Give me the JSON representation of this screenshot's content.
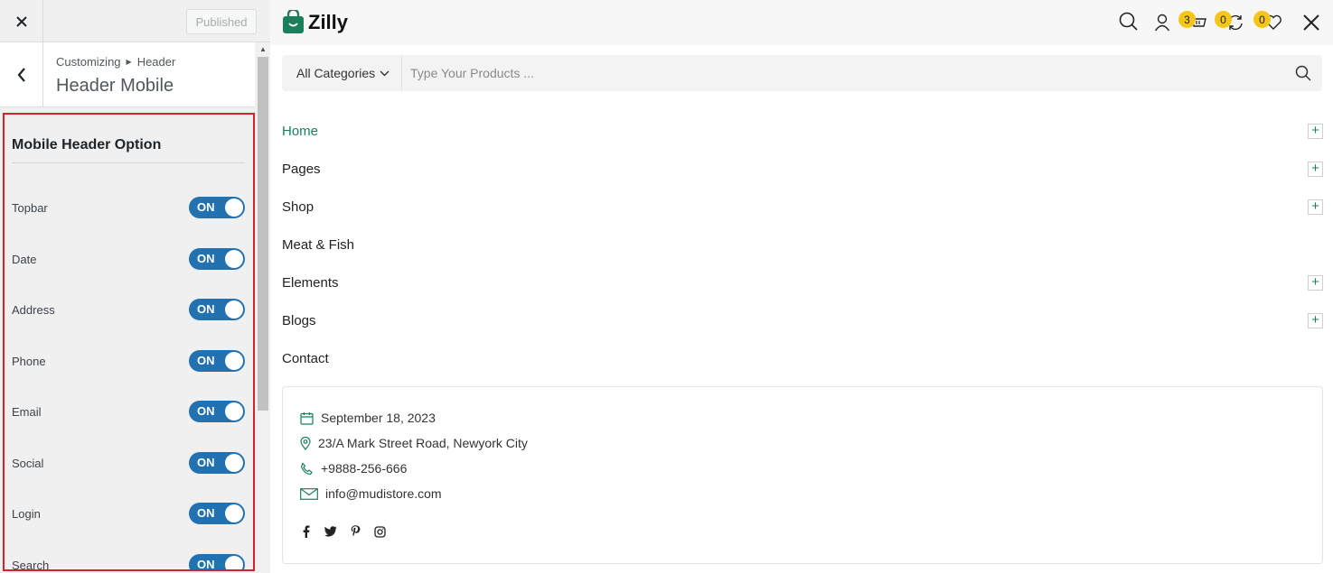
{
  "customizer": {
    "close_icon": "close-icon",
    "published_label": "Published",
    "breadcrumb_root": "Customizing",
    "breadcrumb_parent": "Header",
    "section_title": "Header Mobile",
    "options_heading": "Mobile Header Option",
    "options": [
      {
        "label": "Topbar",
        "state": "ON"
      },
      {
        "label": "Date",
        "state": "ON"
      },
      {
        "label": "Address",
        "state": "ON"
      },
      {
        "label": "Phone",
        "state": "ON"
      },
      {
        "label": "Email",
        "state": "ON"
      },
      {
        "label": "Social",
        "state": "ON"
      },
      {
        "label": "Login",
        "state": "ON"
      },
      {
        "label": "Search",
        "state": "ON"
      }
    ],
    "colors": {
      "toggle_on": "#2271b1",
      "highlight_border": "#d6212a"
    }
  },
  "preview": {
    "logo_text": "Zilly",
    "badges": {
      "cart": "3",
      "compare": "0",
      "wishlist": "0"
    },
    "search": {
      "category_label": "All Categories",
      "placeholder": "Type Your Products ..."
    },
    "menu": [
      {
        "label": "Home",
        "has_submenu": true,
        "active": true
      },
      {
        "label": "Pages",
        "has_submenu": true
      },
      {
        "label": "Shop",
        "has_submenu": true
      },
      {
        "label": "Meat & Fish",
        "has_submenu": false
      },
      {
        "label": "Elements",
        "has_submenu": true
      },
      {
        "label": "Blogs",
        "has_submenu": true
      },
      {
        "label": "Contact",
        "has_submenu": false
      }
    ],
    "info": {
      "date": "September 18, 2023",
      "address": "23/A Mark Street Road, Newyork City",
      "phone": "+9888-256-666",
      "email": "info@mudistore.com"
    },
    "social_icons": [
      "facebook-icon",
      "twitter-icon",
      "pinterest-icon",
      "instagram-icon"
    ],
    "colors": {
      "brand_green": "#1a7f5a",
      "badge_yellow": "#f5c518"
    }
  }
}
